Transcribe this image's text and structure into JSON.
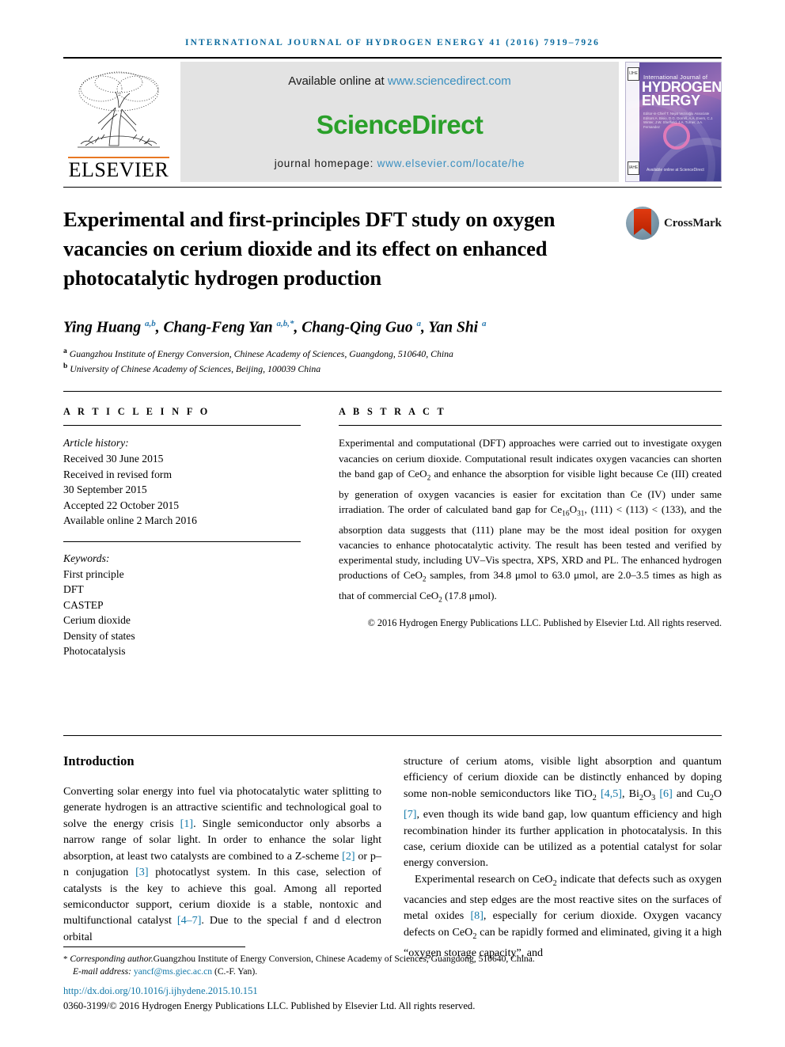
{
  "running_head": "International Journal of Hydrogen Energy 41 (2016) 7919–7926",
  "masthead": {
    "publisher_name": "ELSEVIER",
    "available_prefix": "Available online at ",
    "available_link": "www.sciencedirect.com",
    "sciencedirect_word": "ScienceDirect",
    "homepage_prefix": "journal homepage: ",
    "homepage_link": "www.elsevier.com/locate/he",
    "cover": {
      "line_small": "International Journal of",
      "line_big_1": "HYDROGEN",
      "line_big_2": "ENERGY",
      "editors": "Editor-in-Chief  T. Nejat Veziroğlu\nAssociate Editors  A. Bisio, D.G. Dorrell, A.A. Evers, C.J. Winter, J.W. Sheffield, J.A. Turner, J.A. Fernandez",
      "footer_text": "Available online at\nScienceDirect",
      "badge_top": "IJHE",
      "badge_bottom": "IAHE"
    }
  },
  "article": {
    "title": "Experimental and first-principles DFT study on oxygen vacancies on cerium dioxide and its effect on enhanced photocatalytic hydrogen production",
    "crossmark_label": "CrossMark",
    "authors_html": "Ying Huang <sup>a,b</sup>, Chang-Feng Yan <sup>a,b,*</sup>, Chang-Qing Guo <sup>a</sup>, Yan Shi <sup>a</sup>",
    "authors_plain": "Ying Huang a,b, Chang-Feng Yan a,b,*, Chang-Qing Guo a, Yan Shi a",
    "affiliations": [
      {
        "marker": "a",
        "text": "Guangzhou Institute of Energy Conversion, Chinese Academy of Sciences, Guangdong, 510640, China"
      },
      {
        "marker": "b",
        "text": "University of Chinese Academy of Sciences, Beijing, 100039 China"
      }
    ]
  },
  "article_info": {
    "heading": "A R T I C L E   I N F O",
    "history_label": "Article history:",
    "history": [
      "Received 30 June 2015",
      "Received in revised form",
      "30 September 2015",
      "Accepted 22 October 2015",
      "Available online 2 March 2016"
    ],
    "keywords_label": "Keywords:",
    "keywords": [
      "First principle",
      "DFT",
      "CASTEP",
      "Cerium dioxide",
      "Density of states",
      "Photocatalysis"
    ]
  },
  "abstract": {
    "heading": "A B S T R A C T",
    "text": "Experimental and computational (DFT) approaches were carried out to investigate oxygen vacancies on cerium dioxide. Computational result indicates oxygen vacancies can shorten the band gap of CeO2 and enhance the absorption for visible light because Ce (III) created by generation of oxygen vacancies is easier for excitation than Ce (IV) under same irradiation. The order of calculated band gap for Ce16O31, (111) < (113) < (133), and the absorption data suggests that (111) plane may be the most ideal position for oxygen vacancies to enhance photocatalytic activity. The result has been tested and verified by experimental study, including UV–Vis spectra, XPS, XRD and PL. The enhanced hydrogen productions of CeO2 samples, from 34.8 μmol to 63.0 μmol, are 2.0–3.5 times as high as that of commercial CeO2 (17.8 μmol).",
    "copyright": "© 2016 Hydrogen Energy Publications LLC. Published by Elsevier Ltd. All rights reserved."
  },
  "body": {
    "section_heading": "Introduction",
    "left_paragraph": "Converting solar energy into fuel via photocatalytic water splitting to generate hydrogen is an attractive scientific and technological goal to solve the energy crisis [1]. Single semiconductor only absorbs a narrow range of solar light. In order to enhance the solar light absorption, at least two catalysts are combined to a Z-scheme [2] or p–n conjugation [3] photocatlyst system. In this case, selection of catalysts is the key to achieve this goal. Among all reported semiconductor support, cerium dioxide is a stable, nontoxic and multifunctional catalyst [4–7]. Due to the special f and d electron orbital",
    "right_paragraph_1": "structure of cerium atoms, visible light absorption and quantum efficiency of cerium dioxide can be distinctly enhanced by doping some non-noble semiconductors like TiO2 [4,5], Bi2O3 [6] and Cu2O [7], even though its wide band gap, low quantum efficiency and high recombination hinder its further application in photocatalysis. In this case, cerium dioxide can be utilized as a potential catalyst for solar energy conversion.",
    "right_paragraph_2": "Experimental research on CeO2 indicate that defects such as oxygen vacancies and step edges are the most reactive sites on the surfaces of metal oxides [8], especially for cerium dioxide. Oxygen vacancy defects on CeO2 can be rapidly formed and eliminated, giving it a high “oxygen storage capacity”, and"
  },
  "footer": {
    "corresponding_star": "*",
    "corresponding_label": "Corresponding author.",
    "corresponding_address": "Guangzhou Institute of Energy Conversion, Chinese Academy of Sciences, Guangdong, 510640, China.",
    "email_label": "E-mail address: ",
    "email": "yancf@ms.giec.ac.cn",
    "email_owner": " (C.-F. Yan).",
    "doi": "http://dx.doi.org/10.1016/j.ijhydene.2015.10.151",
    "issn_line": "0360-3199/© 2016 Hydrogen Energy Publications LLC. Published by Elsevier Ltd. All rights reserved."
  },
  "colors": {
    "runhead_blue": "#0b6a9e",
    "link_blue": "#1278a8",
    "sd_green": "#2aa02a",
    "sd_link": "#3a8fc0",
    "elsevier_orange": "#e87722"
  }
}
